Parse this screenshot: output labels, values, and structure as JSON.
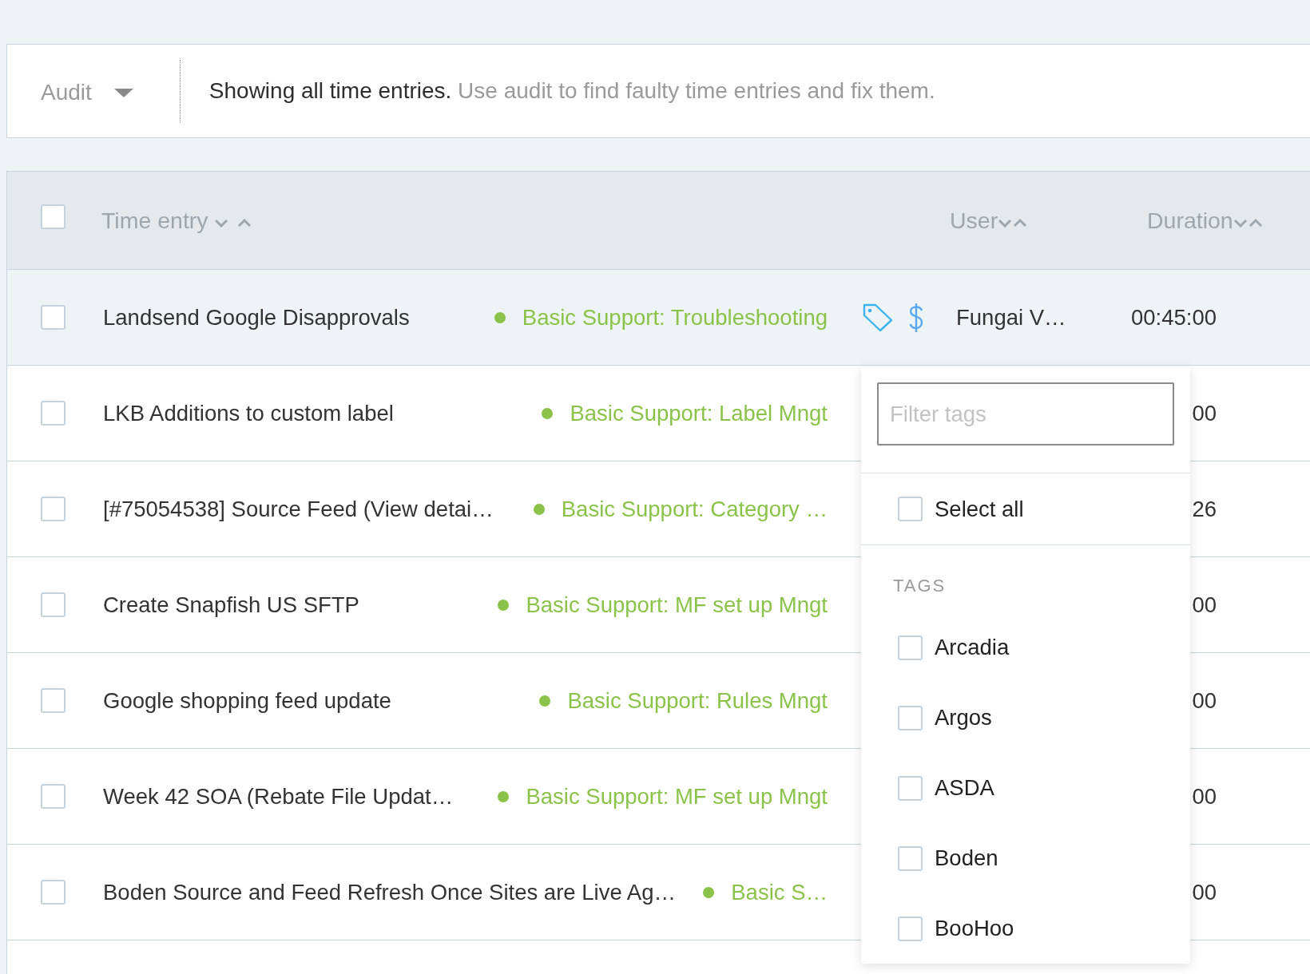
{
  "filter_bar": {
    "audit_dropdown": {
      "label": "Audit"
    },
    "message": "Showing all time entries.",
    "hint": "Use audit to find faulty time entries and fix them."
  },
  "table": {
    "select_all": {
      "checked": false
    },
    "columns": [
      {
        "kind": "title",
        "label": "Time entry"
      },
      {
        "kind": "user",
        "label": "User"
      },
      {
        "kind": "duration",
        "label": "Duration"
      }
    ],
    "rows": [
      {
        "title": "Landsend Google Disapprovals",
        "project": "Basic Support: Troubleshooting",
        "highlighted": true,
        "checked": false,
        "billable": true,
        "user": "Fungai V…",
        "duration": "00:45:00"
      },
      {
        "title": "LKB Additions to custom label",
        "project": "Basic Support: Label Mngt",
        "highlighted": false,
        "checked": false,
        "duration": "00"
      },
      {
        "title": "[#75054538] Source Feed (View detai…",
        "project": "Basic Support: Category …",
        "highlighted": false,
        "checked": false,
        "duration": "26"
      },
      {
        "title": "Create Snapfish US SFTP",
        "project": "Basic Support: MF set up Mngt",
        "highlighted": false,
        "checked": false,
        "duration": "00"
      },
      {
        "title": "Google shopping feed update",
        "project": "Basic Support: Rules Mngt",
        "highlighted": false,
        "checked": false,
        "duration": "00"
      },
      {
        "title": "Week 42 SOA (Rebate File Updat…",
        "project": "Basic Support: MF set up Mngt",
        "highlighted": false,
        "checked": false,
        "duration": "00"
      },
      {
        "title": "Boden Source and Feed Refresh Once Sites are Live Ag…",
        "project": "Basic S…",
        "highlighted": false,
        "checked": false,
        "duration": "00"
      }
    ]
  },
  "tag_menu": {
    "filter": {
      "placeholder": "Filter tags"
    },
    "select_all": {
      "label": "Select all",
      "checked": false
    },
    "section": "TAGS",
    "tags": [
      {
        "label": "Arcadia",
        "checked": false
      },
      {
        "label": "Argos",
        "checked": false
      },
      {
        "label": "ASDA",
        "checked": false
      },
      {
        "label": "Boden",
        "checked": false
      },
      {
        "label": "BooHoo",
        "checked": false
      }
    ]
  }
}
